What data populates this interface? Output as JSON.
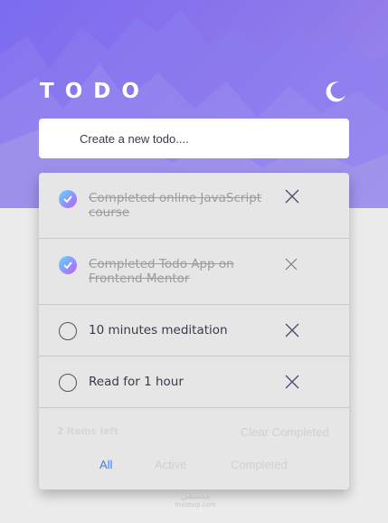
{
  "app": {
    "title": "TODO",
    "theme_icon": "moon-icon"
  },
  "new_todo": {
    "placeholder": "Create a new todo...."
  },
  "todos": [
    {
      "text": "Completed online JavaScript course",
      "completed": true,
      "check_icon": "checkmark-icon",
      "delete_icon": "close-icon"
    },
    {
      "text": "Completed Todo App on Frontend Mentor",
      "completed": true,
      "check_icon": "checkmark-icon",
      "delete_icon": "close-icon"
    },
    {
      "text": "10 minutes meditation",
      "completed": false,
      "delete_icon": "close-icon"
    },
    {
      "text": "Read for 1 hour",
      "completed": false,
      "delete_icon": "close-icon"
    }
  ],
  "footer": {
    "items_left": "2 items left",
    "clear_completed": "Clear Completed",
    "filters": [
      {
        "label": "All",
        "active": true
      },
      {
        "label": "Active",
        "active": false
      },
      {
        "label": "Completed",
        "active": false
      }
    ]
  },
  "watermark": {
    "arabic": "مستقل",
    "latin": "mostaql.com"
  },
  "colors": {
    "accent_blue": "#3a7bfd",
    "check_gradient_start": "#57ddff",
    "check_gradient_end": "#c058f3",
    "hero_purple": "#7b6cf0"
  }
}
